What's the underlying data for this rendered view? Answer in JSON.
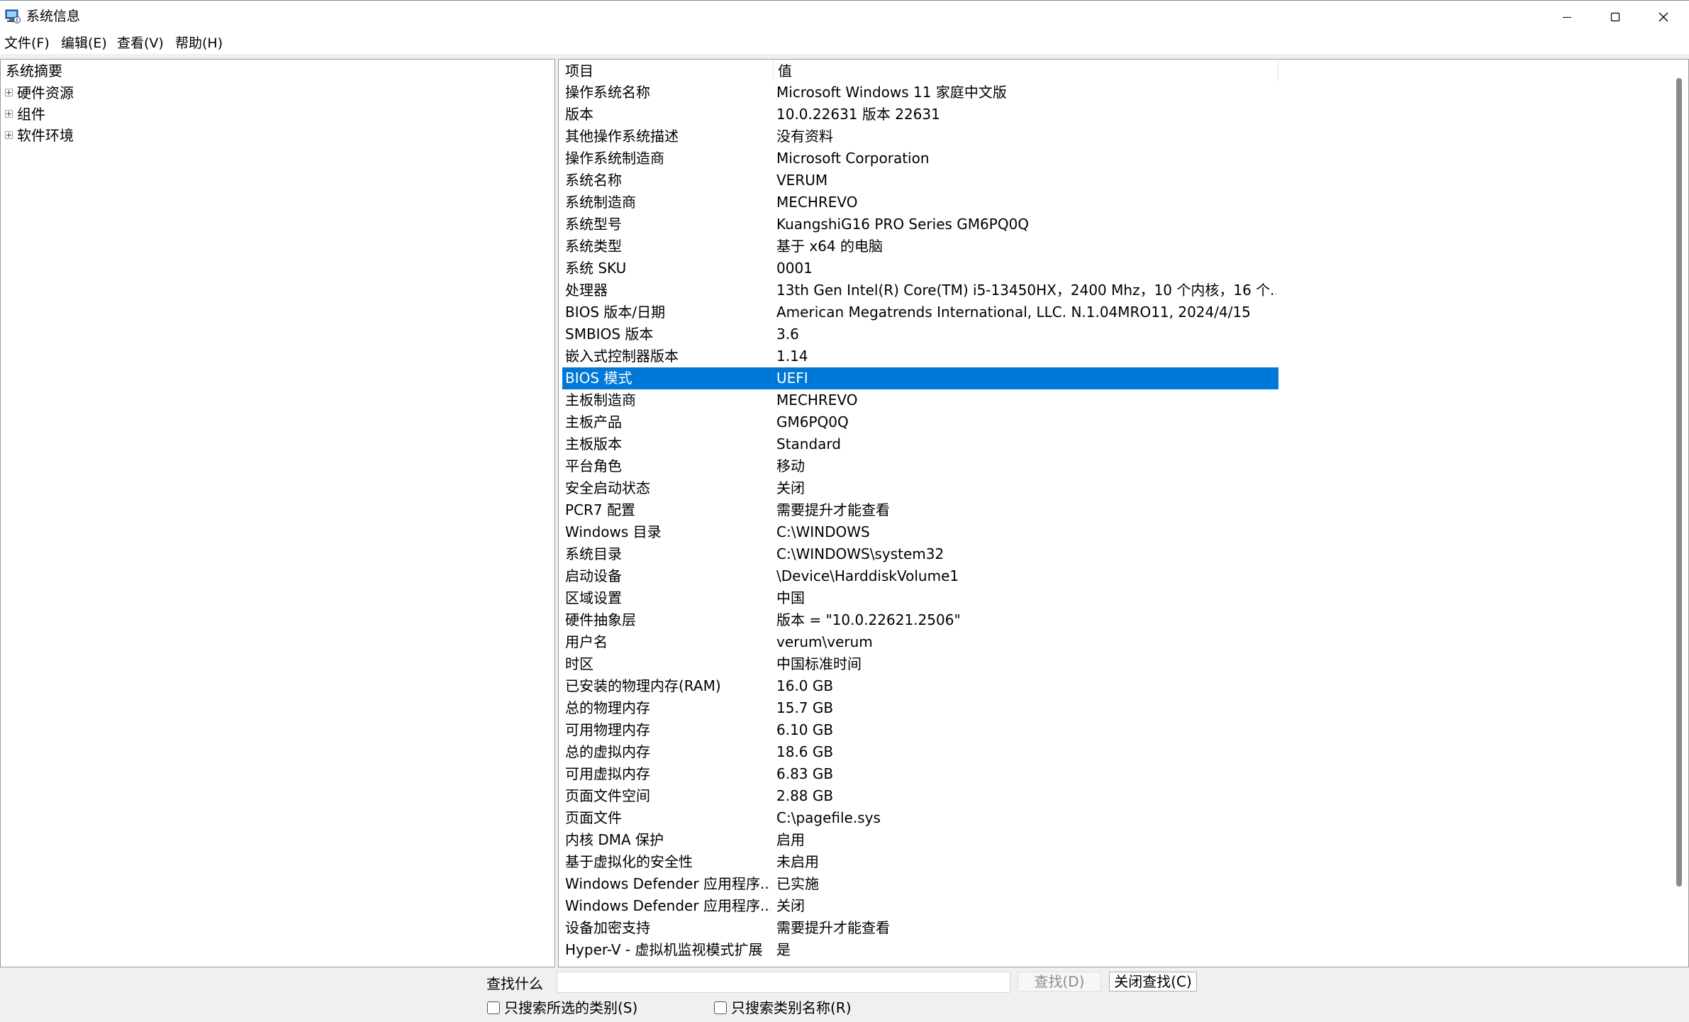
{
  "window": {
    "title": "系统信息"
  },
  "menu": [
    "文件(F)",
    "编辑(E)",
    "查看(V)",
    "帮助(H)"
  ],
  "tree": {
    "root": "系统摘要",
    "nodes": [
      "硬件资源",
      "组件",
      "软件环境"
    ]
  },
  "list": {
    "headers": {
      "item": "项目",
      "value": "值"
    },
    "selected_index": 14,
    "rows": [
      {
        "item": "操作系统名称",
        "value": "Microsoft Windows 11 家庭中文版"
      },
      {
        "item": "版本",
        "value": "10.0.22631 版本 22631"
      },
      {
        "item": "其他操作系统描述",
        "value": "没有资料"
      },
      {
        "item": "操作系统制造商",
        "value": "Microsoft Corporation"
      },
      {
        "item": "系统名称",
        "value": "VERUM"
      },
      {
        "item": "系统制造商",
        "value": "MECHREVO"
      },
      {
        "item": "系统型号",
        "value": "KuangshiG16 PRO Series GM6PQ0Q"
      },
      {
        "item": "系统类型",
        "value": "基于 x64 的电脑"
      },
      {
        "item": "系统 SKU",
        "value": "0001"
      },
      {
        "item": "处理器",
        "value": "13th Gen Intel(R) Core(TM) i5-13450HX，2400 Mhz，10 个内核，16 个..."
      },
      {
        "item": "BIOS 版本/日期",
        "value": "American Megatrends International, LLC. N.1.04MRO11, 2024/4/15"
      },
      {
        "item": "SMBIOS 版本",
        "value": "3.6"
      },
      {
        "item": "嵌入式控制器版本",
        "value": "1.14"
      },
      {
        "item": "BIOS 模式",
        "value": "UEFI"
      },
      {
        "item": "主板制造商",
        "value": "MECHREVO"
      },
      {
        "item": "主板产品",
        "value": "GM6PQ0Q"
      },
      {
        "item": "主板版本",
        "value": "Standard"
      },
      {
        "item": "平台角色",
        "value": "移动"
      },
      {
        "item": "安全启动状态",
        "value": "关闭"
      },
      {
        "item": "PCR7 配置",
        "value": "需要提升才能查看"
      },
      {
        "item": "Windows 目录",
        "value": "C:\\WINDOWS"
      },
      {
        "item": "系统目录",
        "value": "C:\\WINDOWS\\system32"
      },
      {
        "item": "启动设备",
        "value": "\\Device\\HarddiskVolume1"
      },
      {
        "item": "区域设置",
        "value": "中国"
      },
      {
        "item": "硬件抽象层",
        "value": "版本 = \"10.0.22621.2506\""
      },
      {
        "item": "用户名",
        "value": "verum\\verum"
      },
      {
        "item": "时区",
        "value": "中国标准时间"
      },
      {
        "item": "已安装的物理内存(RAM)",
        "value": "16.0 GB"
      },
      {
        "item": "总的物理内存",
        "value": "15.7 GB"
      },
      {
        "item": "可用物理内存",
        "value": "6.10 GB"
      },
      {
        "item": "总的虚拟内存",
        "value": "18.6 GB"
      },
      {
        "item": "可用虚拟内存",
        "value": "6.83 GB"
      },
      {
        "item": "页面文件空间",
        "value": "2.88 GB"
      },
      {
        "item": "页面文件",
        "value": "C:\\pagefile.sys"
      },
      {
        "item": "内核 DMA 保护",
        "value": "启用"
      },
      {
        "item": "基于虚拟化的安全性",
        "value": "未启用"
      },
      {
        "item": "Windows Defender 应用程序...",
        "value": "已实施"
      },
      {
        "item": "Windows Defender 应用程序...",
        "value": "关闭"
      },
      {
        "item": "设备加密支持",
        "value": "需要提升才能查看"
      },
      {
        "item": "Hyper-V - 虚拟机监视模式扩展",
        "value": "是"
      }
    ]
  },
  "find": {
    "label": "查找什么",
    "input_value": "",
    "find_button": "查找(D)",
    "close_button": "关闭查找(C)",
    "checkbox_selected_category": "只搜索所选的类别(S)",
    "checkbox_category_names": "只搜索类别名称(R)"
  },
  "colors": {
    "selection": "#0078d7",
    "pane_background": "#ffffff",
    "chrome_background": "#f0f0f0"
  },
  "icons": {
    "app": "system-information-icon",
    "minimize": "minimize-icon",
    "maximize": "maximize-icon",
    "close": "close-icon",
    "expander": "plus-box-icon"
  }
}
